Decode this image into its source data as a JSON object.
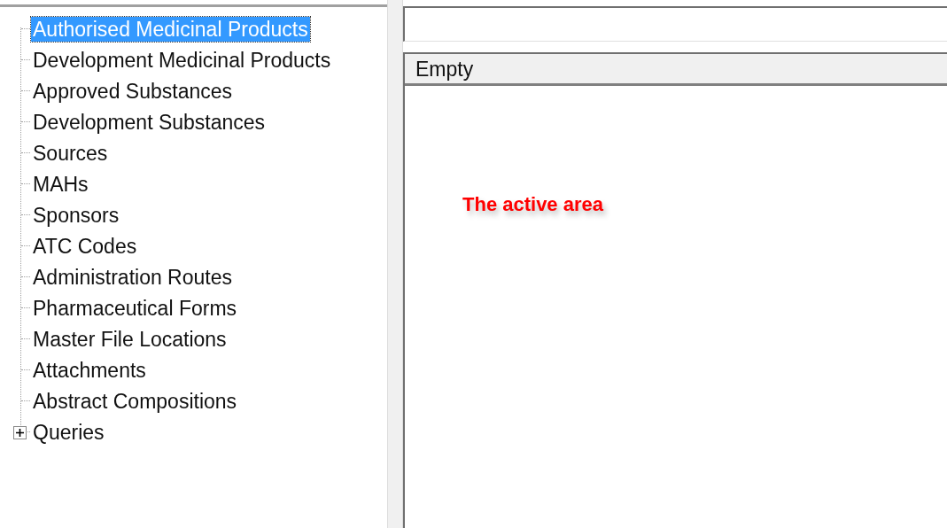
{
  "tree": {
    "items": [
      {
        "label": "Authorised Medicinal Products",
        "selected": true,
        "has_children": false
      },
      {
        "label": "Development Medicinal Products",
        "selected": false,
        "has_children": false
      },
      {
        "label": "Approved Substances",
        "selected": false,
        "has_children": false
      },
      {
        "label": "Development Substances",
        "selected": false,
        "has_children": false
      },
      {
        "label": "Sources",
        "selected": false,
        "has_children": false
      },
      {
        "label": "MAHs",
        "selected": false,
        "has_children": false
      },
      {
        "label": "Sponsors",
        "selected": false,
        "has_children": false
      },
      {
        "label": "ATC Codes",
        "selected": false,
        "has_children": false
      },
      {
        "label": "Administration Routes",
        "selected": false,
        "has_children": false
      },
      {
        "label": "Pharmaceutical Forms",
        "selected": false,
        "has_children": false
      },
      {
        "label": "Master File Locations",
        "selected": false,
        "has_children": false
      },
      {
        "label": "Attachments",
        "selected": false,
        "has_children": false
      },
      {
        "label": "Abstract Compositions",
        "selected": false,
        "has_children": false
      },
      {
        "label": "Queries",
        "selected": false,
        "has_children": true
      }
    ]
  },
  "list": {
    "column_1": "Empty"
  },
  "annotation": "The active area"
}
